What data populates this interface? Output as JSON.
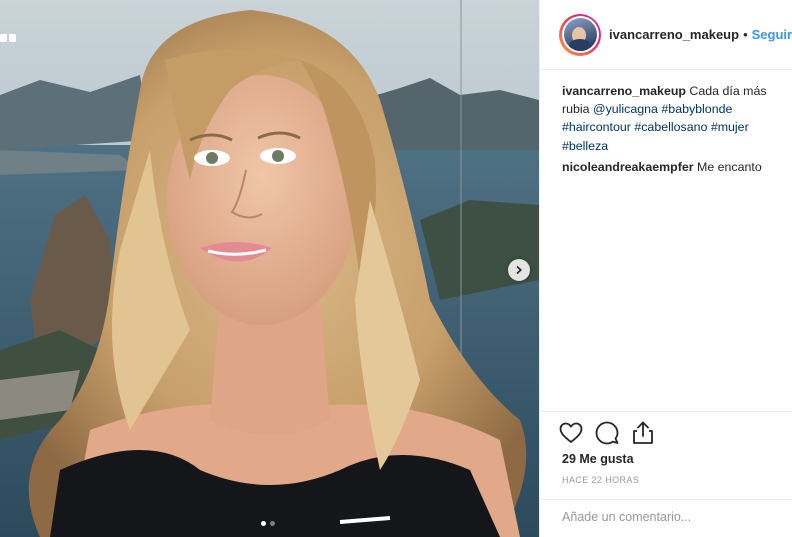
{
  "post": {
    "username": "ivancarreno_makeup",
    "separator": "•",
    "follow_label": "Seguir"
  },
  "comments": [
    {
      "user": "ivancarreno_makeup",
      "text": "Cada día más rubia",
      "tags": [
        "@yulicagna",
        "#babyblonde",
        "#haircontour",
        "#cabellosano",
        "#mujer",
        "#belleza"
      ]
    },
    {
      "user": "nicoleandreakaempfer",
      "text": "Me encanto"
    }
  ],
  "stats": {
    "likes": "29 Me gusta",
    "time": "HACE 22 HORAS"
  },
  "comment_box": {
    "placeholder": "Añade un comentario..."
  },
  "icons": {
    "like": "heart-icon",
    "comment": "comment-icon",
    "share": "share-icon",
    "next": "chevron-right-icon",
    "multi": "carousel-icon"
  },
  "carousel": {
    "total": 2,
    "current": 1
  },
  "colors": {
    "link": "#003569",
    "follow": "#3897f0",
    "meta": "#999999"
  }
}
